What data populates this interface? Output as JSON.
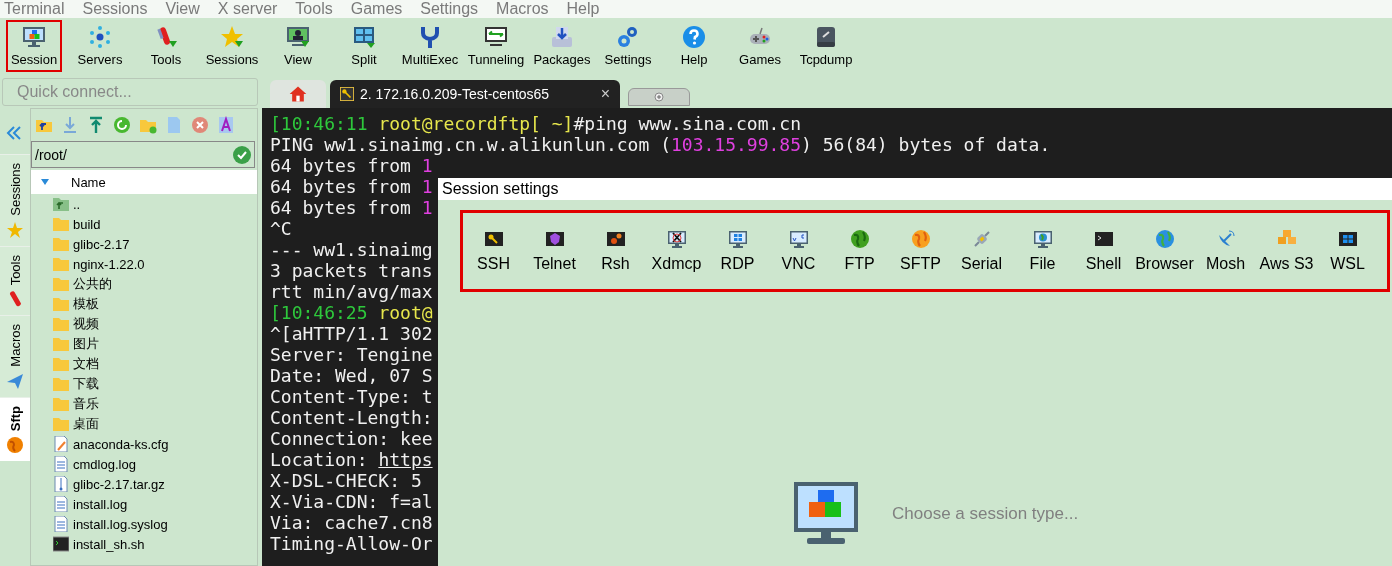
{
  "menu_bar": {
    "items": [
      "Terminal",
      "Sessions",
      "View",
      "X server",
      "Tools",
      "Games",
      "Settings",
      "Macros",
      "Help"
    ]
  },
  "toolbar": {
    "buttons": [
      {
        "label": "Session",
        "highlighted": true
      },
      {
        "label": "Servers",
        "highlighted": false
      },
      {
        "label": "Tools",
        "highlighted": false
      },
      {
        "label": "Sessions",
        "highlighted": false
      },
      {
        "label": "View",
        "highlighted": false
      },
      {
        "label": "Split",
        "highlighted": false
      },
      {
        "label": "MultiExec",
        "highlighted": false
      },
      {
        "label": "Tunneling",
        "highlighted": false
      },
      {
        "label": "Packages",
        "highlighted": false
      },
      {
        "label": "Settings",
        "highlighted": false
      },
      {
        "label": "Help",
        "highlighted": false
      },
      {
        "label": "Games",
        "highlighted": false
      },
      {
        "label": "Tcpdump",
        "highlighted": false
      }
    ]
  },
  "quick_connect": {
    "placeholder": "Quick connect..."
  },
  "tabs": [
    {
      "kind": "home",
      "selected": false
    },
    {
      "kind": "session",
      "label": "2. 172.16.0.209-Test-centos65",
      "close": "×",
      "selected": true
    },
    {
      "kind": "new",
      "selected": false
    }
  ],
  "side_tabs": [
    {
      "label": "Sessions",
      "selected": false
    },
    {
      "label": "Tools",
      "selected": false
    },
    {
      "label": "Macros",
      "selected": false
    },
    {
      "label": "Sftp",
      "selected": true
    }
  ],
  "sftp": {
    "path": "/root/",
    "columns": [
      "Name"
    ],
    "files": [
      {
        "name": "..",
        "kind": "parent"
      },
      {
        "name": "build",
        "kind": "folder"
      },
      {
        "name": "glibc-2.17",
        "kind": "folder"
      },
      {
        "name": "nginx-1.22.0",
        "kind": "folder"
      },
      {
        "name": "公共的",
        "kind": "folder"
      },
      {
        "name": "模板",
        "kind": "folder"
      },
      {
        "name": "视频",
        "kind": "folder"
      },
      {
        "name": "图片",
        "kind": "folder"
      },
      {
        "name": "文档",
        "kind": "folder"
      },
      {
        "name": "下载",
        "kind": "folder"
      },
      {
        "name": "音乐",
        "kind": "folder"
      },
      {
        "name": "桌面",
        "kind": "folder"
      },
      {
        "name": "anaconda-ks.cfg",
        "kind": "config"
      },
      {
        "name": "cmdlog.log",
        "kind": "text"
      },
      {
        "name": "glibc-2.17.tar.gz",
        "kind": "archive"
      },
      {
        "name": "install.log",
        "kind": "text"
      },
      {
        "name": "install.log.syslog",
        "kind": "text"
      },
      {
        "name": "install_sh.sh",
        "kind": "script"
      }
    ]
  },
  "terminal": {
    "lines": [
      [
        {
          "text": "[10:46:11 ",
          "color": "#2ec83c"
        },
        {
          "text": "root@recordftp[ ~]",
          "color": "#e6e64c"
        },
        {
          "text": "#ping www.sina.com.cn",
          "color": "#f0f0f0"
        }
      ],
      [
        {
          "text": "PING ww1.sinaimg.cn.w.alikunlun.com (",
          "color": "#f0f0f0"
        },
        {
          "text": "103.15.99.85",
          "color": "#e040e0"
        },
        {
          "text": ") 56(84) bytes of data.",
          "color": "#f0f0f0"
        }
      ],
      [
        {
          "text": "64 bytes from ",
          "color": "#f0f0f0"
        },
        {
          "text": "1",
          "color": "#e040e0"
        }
      ],
      [
        {
          "text": "64 bytes from ",
          "color": "#f0f0f0"
        },
        {
          "text": "1",
          "color": "#e040e0"
        }
      ],
      [
        {
          "text": "64 bytes from ",
          "color": "#f0f0f0"
        },
        {
          "text": "1",
          "color": "#e040e0"
        }
      ],
      [
        {
          "text": "^C",
          "color": "#f0f0f0"
        }
      ],
      [
        {
          "text": "--- ww1.sinaimg",
          "color": "#f0f0f0"
        }
      ],
      [
        {
          "text": "3 packets trans",
          "color": "#f0f0f0"
        }
      ],
      [
        {
          "text": "rtt min/avg/max",
          "color": "#f0f0f0"
        }
      ],
      [
        {
          "text": "[10:46:25 ",
          "color": "#2ec83c"
        },
        {
          "text": "root@",
          "color": "#e6e64c"
        }
      ],
      [
        {
          "text": "^[aHTTP/1.1 302",
          "color": "#f0f0f0"
        }
      ],
      [
        {
          "text": "Server: Tengine",
          "color": "#f0f0f0"
        }
      ],
      [
        {
          "text": "Date: Wed, 07 S",
          "color": "#f0f0f0"
        }
      ],
      [
        {
          "text": "Content-Type: t",
          "color": "#f0f0f0"
        }
      ],
      [
        {
          "text": "Content-Length:",
          "color": "#f0f0f0"
        }
      ],
      [
        {
          "text": "Connection: kee",
          "color": "#f0f0f0"
        }
      ],
      [
        {
          "text": "Location: ",
          "color": "#f0f0f0"
        },
        {
          "text": "https",
          "color": "#f0f0f0",
          "underline": true
        }
      ],
      [
        {
          "text": "X-DSL-CHECK: 5",
          "color": "#f0f0f0"
        }
      ],
      [
        {
          "text": "X-Via-CDN: f=al",
          "color": "#f0f0f0"
        }
      ],
      [
        {
          "text": "Via: cache7.cn8",
          "color": "#f0f0f0"
        }
      ],
      [
        {
          "text": "Timing-Allow-Or",
          "color": "#f0f0f0"
        }
      ]
    ]
  },
  "session_dialog": {
    "title": "Session settings",
    "types_highlighted": true,
    "types": [
      {
        "label": "SSH"
      },
      {
        "label": "Telnet"
      },
      {
        "label": "Rsh"
      },
      {
        "label": "Xdmcp"
      },
      {
        "label": "RDP"
      },
      {
        "label": "VNC"
      },
      {
        "label": "FTP"
      },
      {
        "label": "SFTP"
      },
      {
        "label": "Serial"
      },
      {
        "label": "File"
      },
      {
        "label": "Shell"
      },
      {
        "label": "Browser"
      },
      {
        "label": "Mosh"
      },
      {
        "label": "Aws S3"
      },
      {
        "label": "WSL"
      }
    ],
    "prompt": "Choose a session type..."
  }
}
